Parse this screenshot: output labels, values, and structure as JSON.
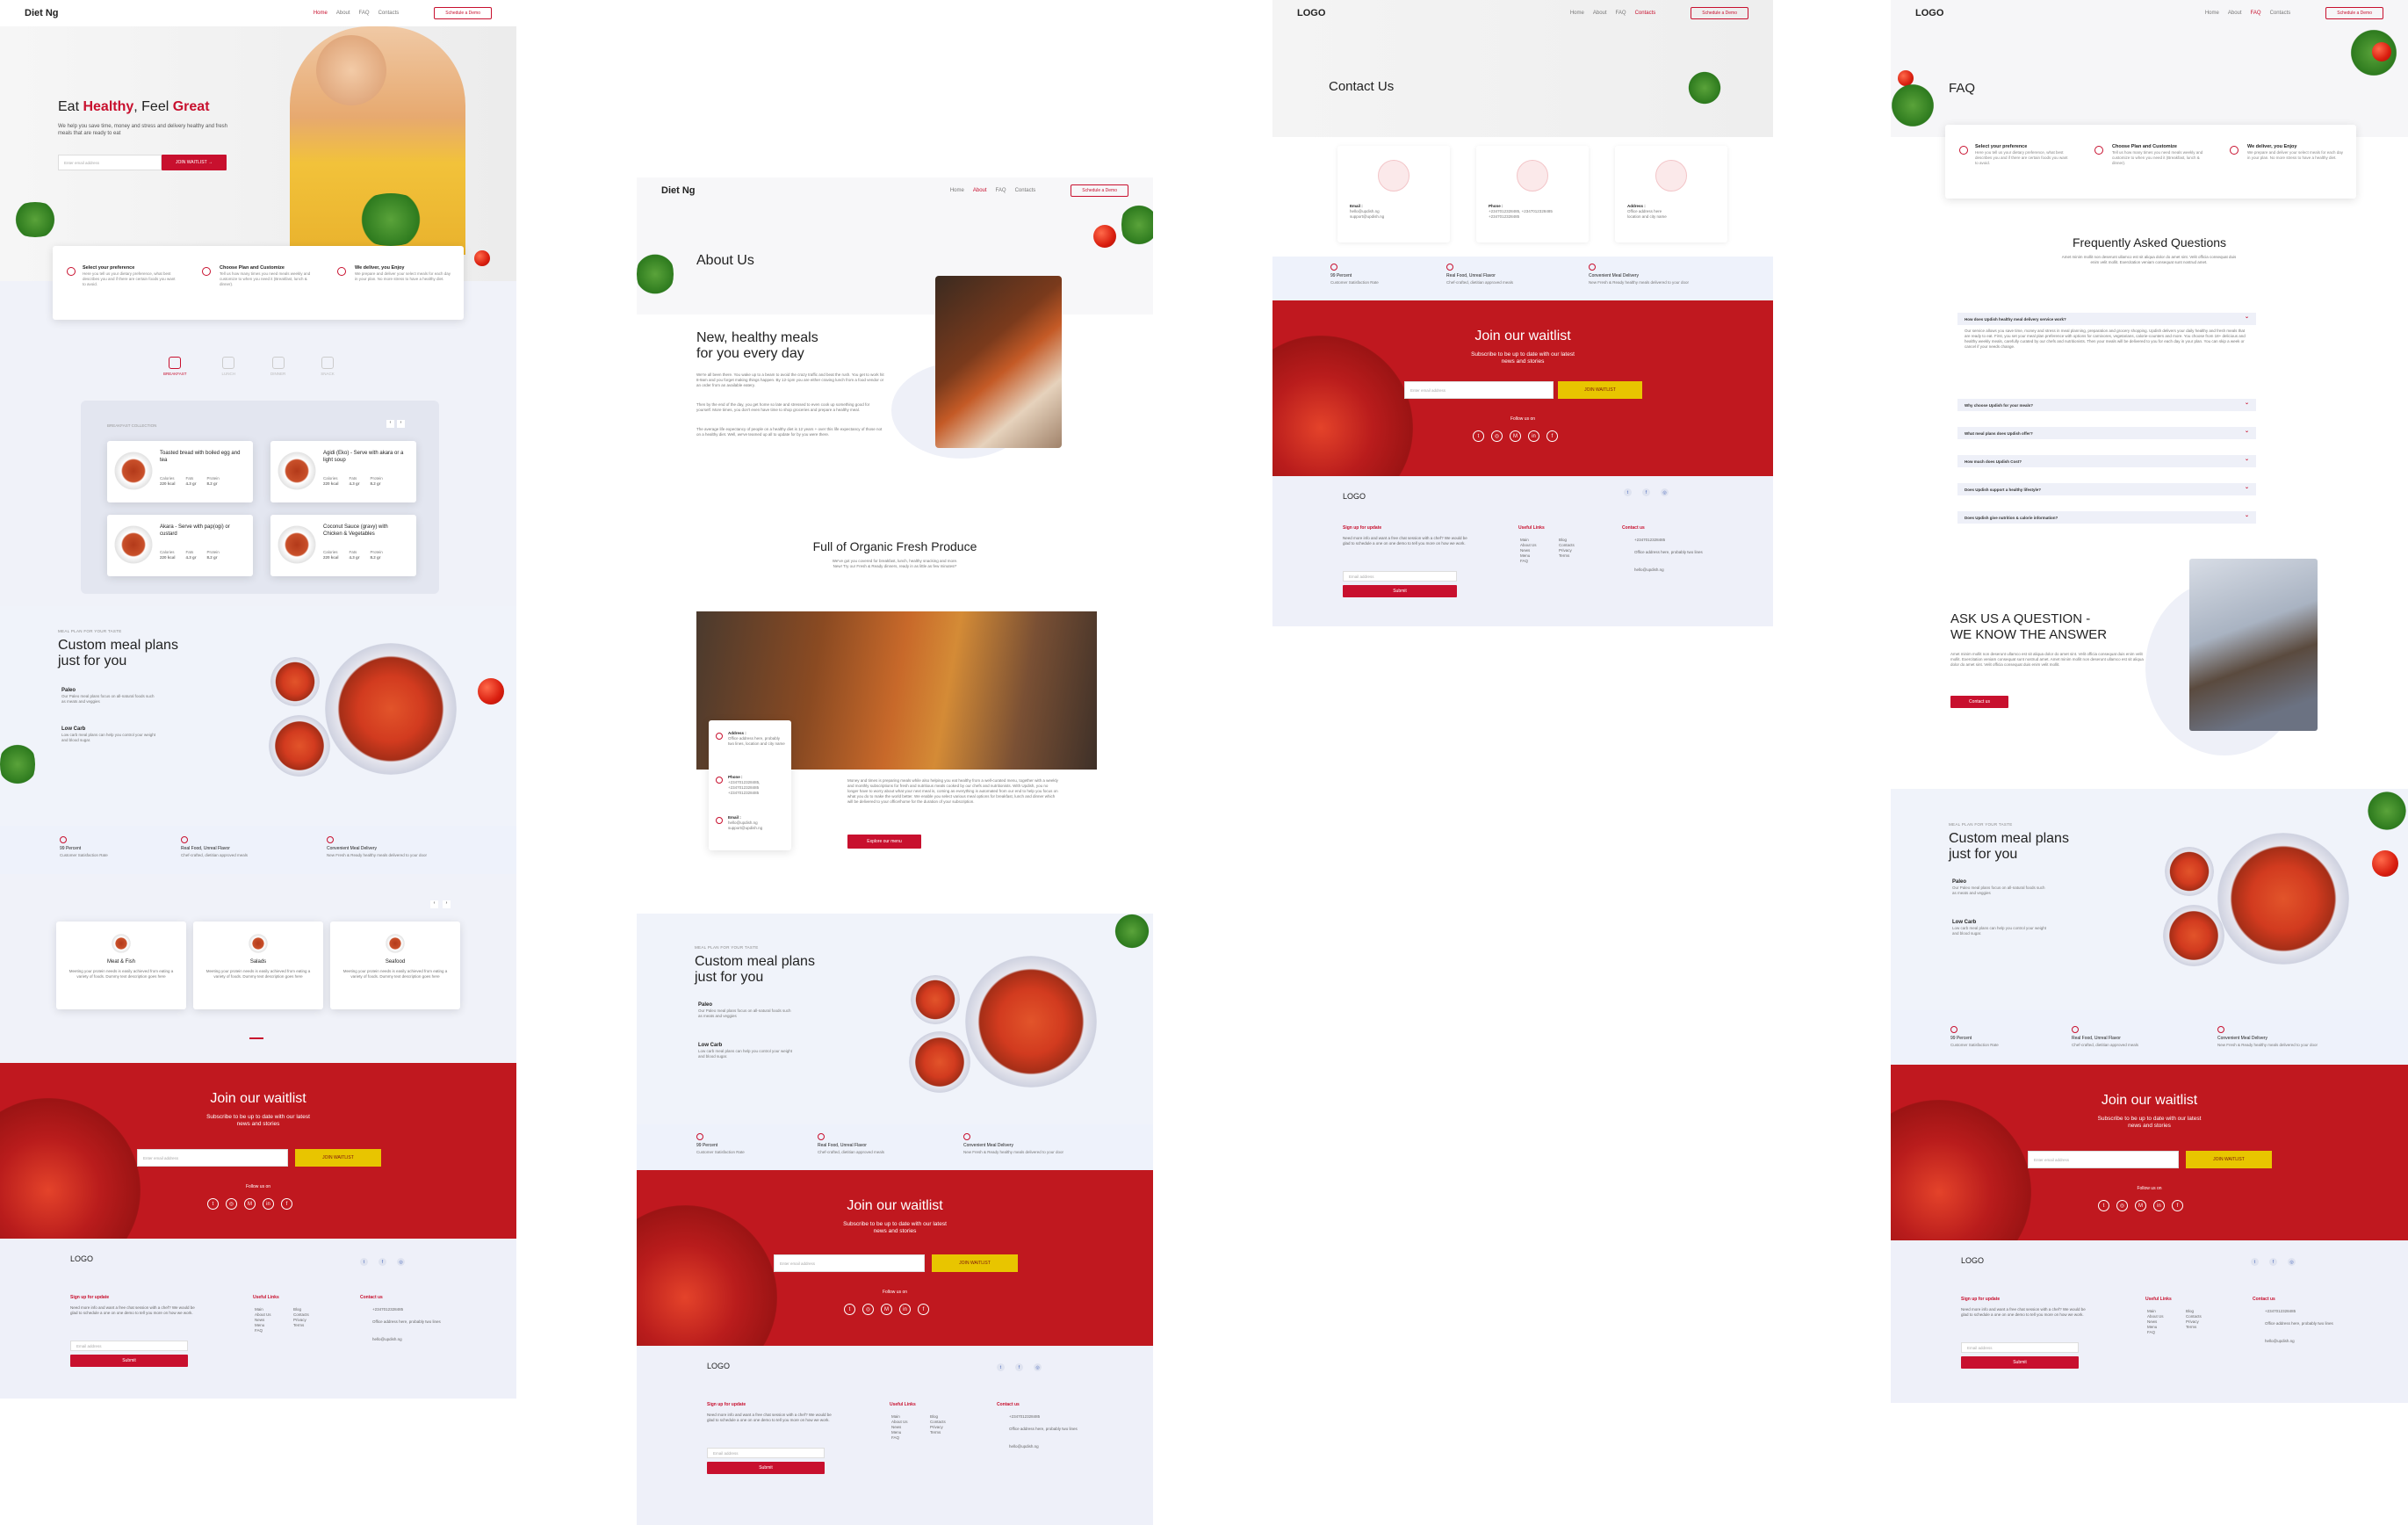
{
  "home": {
    "nav": {
      "logo": "Diet Ng",
      "links": [
        "Home",
        "About",
        "FAQ",
        "Contacts"
      ],
      "demo": "Schedule a Demo"
    },
    "hero": {
      "title_pre": "Eat ",
      "title_red1": "Healthy",
      "title_mid": ", Feel ",
      "title_red2": "Great",
      "subtitle": "We help you save time, money and stress and delivery healthy and fresh meals that are ready to eat",
      "email_placeholder": "Enter email address",
      "cta": "JOIN WAITLIST"
    },
    "steps": [
      {
        "title": "Select your preference",
        "text": "Here you tell us your dietary preference, what best describes you and if there are certain foods you want to avoid."
      },
      {
        "title": "Choose Plan and Customize",
        "text": "Tell us how many times you need meals weekly and customize to when you need it (Breakfast, lunch & dinner)."
      },
      {
        "title": "We deliver, you Enjoy",
        "text": "We prepare and deliver your select meals for each day in your plan. No more stress to have a healthy diet."
      }
    ],
    "meal_tabs": [
      "BREAKFAST",
      "LUNCH",
      "DINNER",
      "SNACK"
    ],
    "collection_label": "BREAKFAST COLLECTION",
    "meals": [
      {
        "name": "Toasted bread with boiled egg and tea",
        "cal": "220 kcal",
        "fat": "4.3 gr",
        "protein": "8.2 gr"
      },
      {
        "name": "Agidi (Eko) - Serve with akara or a light soup",
        "cal": "220 kcal",
        "fat": "4.3 gr",
        "protein": "8.2 gr"
      },
      {
        "name": "Akara - Serve with pap(ogi) or custard",
        "cal": "220 kcal",
        "fat": "4.3 gr",
        "protein": "8.2 gr"
      },
      {
        "name": "Coconut Sauce (gravy) with Chicken & Vegetables",
        "cal": "220 kcal",
        "fat": "4.3 gr",
        "protein": "8.2 gr"
      }
    ],
    "nutrient_labels": {
      "cal": "Calories",
      "fat": "Fats",
      "protein": "Protein"
    },
    "categories": [
      {
        "name": "Meat & Fish",
        "text": "Meeting your protein needs is easily achieved from eating a variety of foods. Dummy text description goes here"
      },
      {
        "name": "Salads",
        "text": "Meeting your protein needs is easily achieved from eating a variety of foods. Dummy text description goes here"
      },
      {
        "name": "Seafood",
        "text": "Meeting your protein needs is easily achieved from eating a variety of foods. Dummy text description goes here"
      }
    ]
  },
  "mealplan": {
    "kicker": "MEAL PLAN FOR YOUR TASTE",
    "title_l1": "Custom meal plans",
    "title_l2": "just for you",
    "items": [
      {
        "name": "Paleo",
        "text": "Our Paleo meal plans focus on all-natural foods such as meats and veggies"
      },
      {
        "name": "Low Carb",
        "text": "Low carb meal plans can help you control your weight and blood sugar."
      }
    ]
  },
  "features": [
    {
      "title": "99 Percent",
      "text": "Customer Satisfaction Rate"
    },
    {
      "title": "Real Food, Unreal Flavor",
      "text": "Chef-crafted, dietitian approved meals"
    },
    {
      "title": "Convenient Meal Delivery",
      "text": "New Fresh & Ready healthy meals delivered to your door"
    }
  ],
  "waitlist": {
    "title": "Join our waitlist",
    "sub1": "Subscribe to be up to date with our latest",
    "sub2": "news and stories",
    "placeholder": "Enter email address",
    "button": "JOIN WAITLIST",
    "follow": "Follow us on"
  },
  "footer": {
    "logo": "LOGO",
    "signup_title": "Sign up for update",
    "signup_text": "Need more info and want a free chat session with a chef? We would be glad to schedule a one on one demo to tell you more on how we work.",
    "email_placeholder": "Email address",
    "submit": "Submit",
    "links_title": "Useful Links",
    "links_col1": [
      "Main",
      "About Us",
      "News",
      "Menu",
      "FAQ"
    ],
    "links_col2": [
      "Blog",
      "Contacts",
      "Privacy",
      "Terms"
    ],
    "contact_title": "Contact us",
    "phone": "+2347012328485",
    "address": "Office address here, probably two lines",
    "email": "hello@updish.ng"
  },
  "about": {
    "nav": {
      "logo": "Diet Ng",
      "links": [
        "Home",
        "About",
        "FAQ",
        "Contacts"
      ],
      "demo": "Schedule a Demo"
    },
    "title": "About Us",
    "h2_l1": "New, healthy meals",
    "h2_l2": "for you every day",
    "p1": "We're all been there. You wake up to a beam to avoid the crazy traffic and beat the rush. You get to work hit 8-9am and you forget making things happen. By 12-1pm you are either craving lunch from a food vendor or an order from an available eatery.",
    "p2": "Then by the end of the day, you get home so late and stressed to even cook up something good for yourself. More times, you don't even have time to shop groceries and prepare a healthy meal.",
    "p3": "The average life expectancy of people on a healthy diet is 12 years + over this life expectancy of those not on a healthy diet. Well, we've teamed up all to update for by you were there.",
    "organic_title": "Full of Organic Fresh Produce",
    "organic_l1": "We've got you covered for breakfast, lunch, healthy snacking and more.",
    "organic_l2": "New! Try our Fresh & Ready dinners, ready in as little as few minutes!*",
    "contact_address_t": "Address :",
    "contact_address": "Office address here, probably two lines, location and city name",
    "contact_phone_t": "Phone :",
    "contact_phone": "+2347012328485, +2347012328485 +2347012328485",
    "contact_email_t": "Email :",
    "contact_email": "hello@updish.ng support@updish.ng",
    "body": "Money and times is preparing meals while also helping you eat healthy from a well-curated menu, together with a weekly and monthly subscriptions for fresh and nutritious meals cooked by our chefs and nutritionists. With Updish, you no longer have to worry about what your next meal is, coming as everything is automated from our end to help you focus on what you do to make the world better. We enable you select various meal options for breakfast, lunch and dinner which will be delivered to your office/home for the duration of your subscription.",
    "cta": "Explore our menu"
  },
  "contact": {
    "nav": {
      "logo": "LOGO",
      "links": [
        "Home",
        "About",
        "FAQ",
        "Contacts"
      ],
      "demo": "Schedule a Demo"
    },
    "title": "Contact Us",
    "cards": [
      {
        "t": "Email :",
        "v1": "hello@updish.ng",
        "v2": "support@updish.ng"
      },
      {
        "t": "Phone :",
        "v1": "+2347012328485, +2347012328485",
        "v2": "+2347012328485"
      },
      {
        "t": "Address :",
        "v1": "Office address here",
        "v2": "location and city name"
      }
    ]
  },
  "faq": {
    "nav": {
      "logo": "LOGO",
      "links": [
        "Home",
        "About",
        "FAQ",
        "Contacts"
      ],
      "demo": "Schedule a Demo"
    },
    "title": "FAQ",
    "heading": "Frequently Asked Questions",
    "intro": "Amet minim mollit non deserunt ullamco est sit aliqua dolor do amet sint. Velit officia consequat duis enim velit mollit. Exercitation veniam consequat sunt nostrud amet.",
    "q1": "How does Updish healthy meal delivery service work?",
    "a1": "Our service allows you save time, money and stress in meal planning, preparation and grocery shopping. Updish delivers your daily healthy and fresh meals that are ready to eat. First, you set your meal plan preference with options for carnivores, vegetarians, calorie-counters and more. You choose from 18+ delicious and healthy weekly meals, carefully curated by our chefs and nutritionists. Then your meals will be delivered to you for each day in your plan. You can skip a week or cancel if your needs change.",
    "questions": [
      "Why choose Updish for your meals?",
      "What meal plans does Updish offer?",
      "How much does Updish Cost?",
      "Does Updish support a healthy lifestyle?",
      "Does Updish give nutrition & calorie information?"
    ],
    "ask_l1": "ASK US A QUESTION  -",
    "ask_l2": "WE KNOW THE ANSWER",
    "ask_text": "Amet minim mollit non deserunt ullamco est sit aliqua dolor do amet sint. Velit officia consequat duis enim velit mollit. Exercitation veniam consequat sunt nostrud amet. Amet minim mollit non deserunt ullamco est sit aliqua dolor do amet sint. Velit officia consequat duis enim velit mollit.",
    "ask_btn": "Contact us"
  },
  "colors": {
    "brand": "#c8102e",
    "waitlist": "#c0181f",
    "yellow": "#e8c500",
    "footer": "#eef0f9"
  }
}
